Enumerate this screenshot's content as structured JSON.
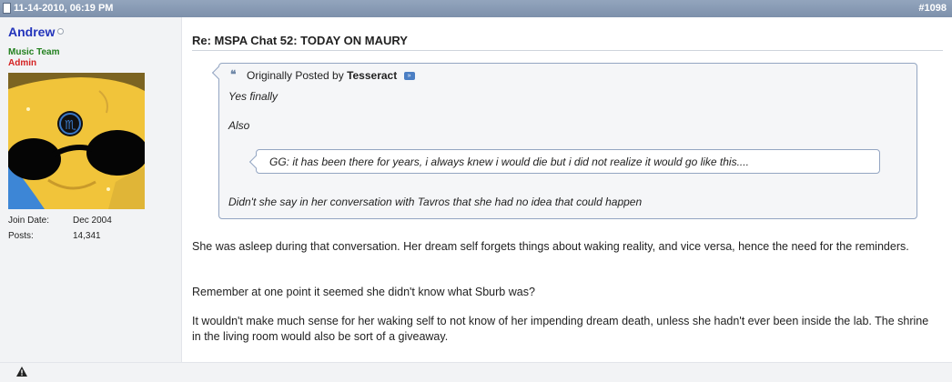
{
  "header": {
    "date": "11-14-2010, 06:19 PM",
    "post_number": "#1098"
  },
  "user": {
    "name": "Andrew",
    "title_primary": "Music Team",
    "title_secondary": "Admin",
    "join_date_label": "Join Date:",
    "join_date": "Dec 2004",
    "posts_label": "Posts:",
    "posts": "14,341"
  },
  "post": {
    "title": "Re: MSPA Chat 52: TODAY ON MAURY",
    "quote": {
      "prefix": "Originally Posted by",
      "author": "Tesseract",
      "line1": "Yes finally",
      "line2": "Also",
      "nested": "GG: it has been there for years, i always knew i would die but i did not realize it would go like this....",
      "line3": "Didn't she say in her conversation with Tavros that she had no idea that could happen"
    },
    "paragraphs": [
      "She was asleep during that conversation. Her dream self forgets things about waking reality, and vice versa, hence the need for the reminders.",
      "Remember at one point it seemed she didn't know what Sburb was?",
      "It wouldn't make much sense for her waking self to not know of her impending dream death, unless she hadn't ever been inside the lab. The shrine in the living room would also be sort of a giveaway."
    ]
  },
  "icons": {
    "header": "document-icon",
    "online": "online-status-icon",
    "quote": "quote-icon",
    "view_post": "view-post-icon",
    "report": "warning-icon"
  }
}
